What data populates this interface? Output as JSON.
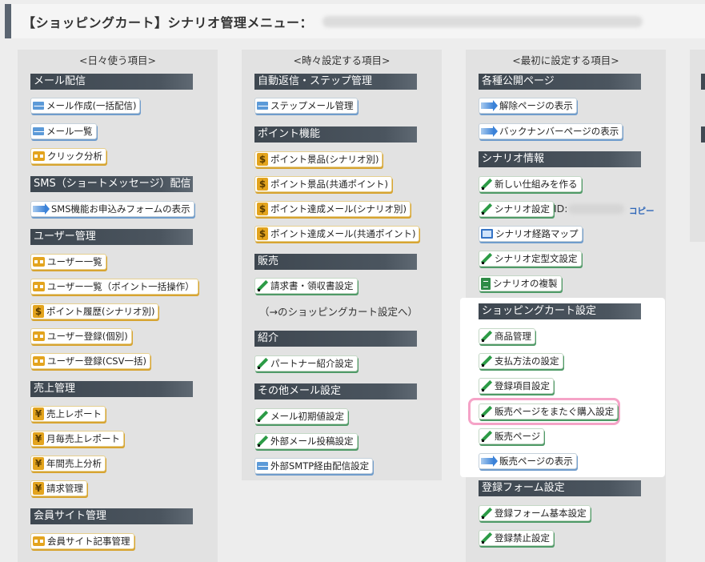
{
  "header": {
    "title": "【ショッピングカート】シナリオ管理メニュー："
  },
  "columns": {
    "daily": {
      "heading": "<日々使う項目>"
    },
    "occasional": {
      "heading": "<時々設定する項目>"
    },
    "initial": {
      "heading": "<最初に設定する項目>"
    }
  },
  "daily": {
    "mail": {
      "title": "メール配信",
      "compose": "メール作成(一括配信)",
      "list": "メール一覧",
      "click": "クリック分析"
    },
    "sms": {
      "title": "SMS（ショートメッセージ）配信",
      "form": "SMS機能お申込みフォームの表示"
    },
    "users": {
      "title": "ユーザー管理",
      "list": "ユーザー一覧",
      "list_bulk": "ユーザー一覧（ポイント一括操作）",
      "points": "ポイント履歴(シナリオ別)",
      "register": "ユーザー登録(個別)",
      "register_csv": "ユーザー登録(CSV一括)"
    },
    "sales": {
      "title": "売上管理",
      "report": "売上レポート",
      "monthly": "月毎売上レポート",
      "yearly": "年間売上分析",
      "invoice": "請求管理"
    },
    "member": {
      "title": "会員サイト管理",
      "articles": "会員サイト記事管理"
    }
  },
  "occasional": {
    "auto": {
      "title": "自動返信・ステップ管理",
      "step": "ステップメール管理"
    },
    "point": {
      "title": "ポイント機能",
      "prize_scenario": "ポイント景品(シナリオ別)",
      "prize_common": "ポイント景品(共通ポイント)",
      "mail_scenario": "ポイント達成メール(シナリオ別)",
      "mail_common": "ポイント達成メール(共通ポイント)"
    },
    "sales": {
      "title": "販売",
      "invoice": "請求書・領収書設定",
      "note": "（→のショッピングカート設定へ）"
    },
    "intro": {
      "title": "紹介",
      "partner": "パートナー紹介設定"
    },
    "other": {
      "title": "その他メール設定",
      "initial": "メール初期値設定",
      "external": "外部メール投稿設定",
      "smtp": "外部SMTP経由配信設定"
    }
  },
  "initial": {
    "public": {
      "title": "各種公開ページ",
      "cancel": "解除ページの表示",
      "backnumber": "バックナンバーページの表示"
    },
    "scenario": {
      "title": "シナリオ情報",
      "new": "新しい仕組みを作る",
      "settings": "シナリオ設定",
      "id_label": "ID:",
      "copy": "コピー",
      "map": "シナリオ経路マップ",
      "template": "シナリオ定型文設定",
      "duplicate": "シナリオの複製"
    },
    "cart": {
      "title": "ショッピングカート設定",
      "products": "商品管理",
      "payment": "支払方法の設定",
      "fields": "登録項目設定",
      "cross": "販売ページをまたぐ購入設定",
      "page": "販売ページ",
      "page_view": "販売ページの表示"
    },
    "form": {
      "title": "登録フォーム設定",
      "basic": "登録フォーム基本設定",
      "ban": "登録禁止設定"
    }
  }
}
